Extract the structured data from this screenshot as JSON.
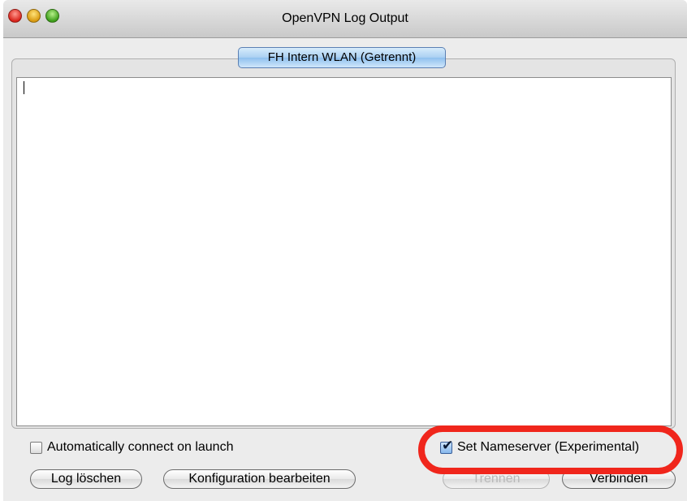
{
  "window": {
    "title": "OpenVPN Log Output"
  },
  "tab": {
    "label": "FH Intern WLAN (Getrennt)"
  },
  "log": {
    "text": ""
  },
  "options": {
    "auto_connect": {
      "label": "Automatically connect on launch",
      "checked": false
    },
    "set_nameserver": {
      "label": "Set Nameserver (Experimental)",
      "checked": true
    }
  },
  "buttons": {
    "clear_log": "Log löschen",
    "edit_config": "Konfiguration bearbeiten",
    "disconnect": "Trennen",
    "connect": "Verbinden"
  },
  "colors": {
    "highlight": "#f0261c",
    "tab_accent": "#8fc0ee"
  }
}
